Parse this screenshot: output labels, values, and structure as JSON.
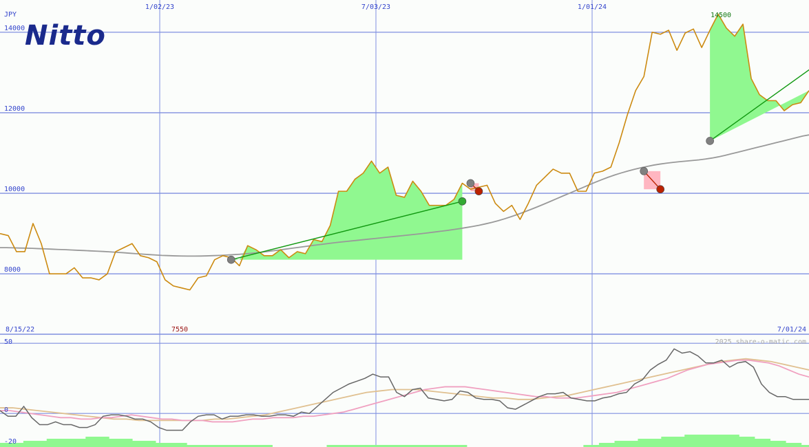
{
  "brand": {
    "logo_text": "Nitto",
    "logo_color": "#1a2a8c"
  },
  "watermark": "2025 share-o-matic.com",
  "colors": {
    "grid": "#7f8fe0",
    "price": "#cc8a10",
    "ma": "#999999",
    "profit_fill": "#90f890",
    "loss_fill": "#ffb6c1",
    "trade_line": "#119911",
    "buy_marker": "#808080",
    "win_marker": "#33aa33",
    "loss_marker": "#bb2200",
    "axis_text": "#3344cc",
    "high_text": "#117711",
    "low_text": "#991111",
    "osc_main": "#666666",
    "osc_signal1": "#f0a0c0",
    "osc_signal2": "#e0c090",
    "volume_fill": "#90f890"
  },
  "chart_data": [
    {
      "type": "line",
      "title": "",
      "currency_label": "JPY",
      "x_tick_labels": [
        "1/02/23",
        "7/03/23",
        "1/01/24"
      ],
      "x_start_label": "8/15/22",
      "x_end_label": "7/01/24",
      "y_ticks": [
        8000,
        10000,
        12000,
        14000
      ],
      "ylim": [
        6500,
        14800
      ],
      "high_label": "14500",
      "low_label": "7550",
      "series": [
        {
          "key": "price",
          "values": [
            9000,
            8950,
            8550,
            8550,
            9250,
            8750,
            8000,
            8000,
            8000,
            8150,
            7900,
            7900,
            7850,
            8000,
            8550,
            8650,
            8750,
            8450,
            8400,
            8300,
            7850,
            7700,
            7650,
            7600,
            7900,
            7950,
            8350,
            8450,
            8400,
            8200,
            8700,
            8600,
            8450,
            8450,
            8600,
            8400,
            8550,
            8500,
            8850,
            8800,
            9200,
            10050,
            10050,
            10350,
            10500,
            10800,
            10500,
            10650,
            9950,
            9900,
            10300,
            10050,
            9700,
            9700,
            9700,
            9850,
            10250,
            10100,
            10150,
            10200,
            9750,
            9550,
            9700,
            9350,
            9750,
            10200,
            10400,
            10600,
            10500,
            10500,
            10050,
            10050,
            10500,
            10550,
            10650,
            11250,
            11950,
            12550,
            12900,
            14000,
            13950,
            14050,
            13550,
            13980,
            14080,
            13620,
            14050,
            14450,
            14100,
            13900,
            14200,
            12850,
            12450,
            12300,
            12300,
            12050,
            12200,
            12250,
            12550
          ]
        },
        {
          "key": "ma",
          "values": [
            8650,
            8650,
            8645,
            8640,
            8638,
            8632,
            8625,
            8620,
            8612,
            8605,
            8600,
            8592,
            8585,
            8578,
            8570,
            8562,
            8555,
            8545,
            8535,
            8525,
            8512,
            8500,
            8490,
            8478,
            8468,
            8458,
            8452,
            8446,
            8442,
            8440,
            8440,
            8442,
            8446,
            8452,
            8458,
            8466,
            8476,
            8486,
            8498,
            8512,
            8528,
            8548,
            8568,
            8588,
            8610,
            8632,
            8654,
            8676,
            8698,
            8718,
            8738,
            8758,
            8778,
            8795,
            8812,
            8828,
            8845,
            8862,
            8878,
            8895,
            8912,
            8928,
            8945,
            8962,
            8978,
            8995,
            9015,
            9035,
            9055,
            9075,
            9098,
            9122,
            9148,
            9175,
            9205,
            9240,
            9278,
            9320,
            9368,
            9420,
            9476,
            9536,
            9598,
            9662,
            9728,
            9796,
            9866,
            9935,
            10002,
            10070,
            10138,
            10208,
            10276,
            10340,
            10400,
            10456,
            10506,
            10552,
            10594,
            10632,
            10668,
            10700,
            10726,
            10748,
            10768,
            10785,
            10800,
            10815,
            10830,
            10850,
            10875,
            10905,
            10940,
            10980,
            11020,
            11060,
            11100,
            11140,
            11180,
            11220,
            11260,
            11300,
            11340,
            11380,
            11420,
            11450
          ]
        }
      ],
      "trades": [
        {
          "entry_index": 28,
          "entry_value": 8350,
          "exit_index": 56,
          "exit_value": 9800,
          "result": "win"
        },
        {
          "entry_index": 57,
          "entry_value": 10250,
          "exit_index": 58,
          "exit_value": 10050,
          "result": "loss"
        },
        {
          "entry_index": 78,
          "entry_value": 10550,
          "exit_index": 80,
          "exit_value": 10100,
          "result": "loss"
        },
        {
          "entry_index": 86,
          "entry_value": 11300,
          "exit_index": 103,
          "exit_value": 13800,
          "result": "win"
        }
      ]
    },
    {
      "type": "line",
      "title": "",
      "y_ticks": [
        50,
        0,
        -20
      ],
      "ylim": [
        -20,
        55
      ],
      "series": [
        {
          "key": "oscillator",
          "values": [
            2,
            -2,
            -2,
            5,
            -3,
            -8,
            -8,
            -6,
            -8,
            -8,
            -10,
            -10,
            -8,
            -2,
            -1,
            -1,
            -2,
            -4,
            -4,
            -6,
            -10,
            -12,
            -12,
            -12,
            -6,
            -2,
            -1,
            -1,
            -4,
            -2,
            -2,
            -1,
            -1,
            -2,
            -2,
            -1,
            -1,
            -2,
            1,
            0,
            5,
            10,
            15,
            18,
            21,
            23,
            25,
            28,
            26,
            26,
            15,
            12,
            17,
            18,
            11,
            10,
            9,
            10,
            16,
            15,
            11,
            10,
            10,
            9,
            4,
            3,
            6,
            9,
            12,
            14,
            14,
            15,
            11,
            10,
            9,
            9,
            11,
            12,
            14,
            15,
            21,
            24,
            31,
            35,
            38,
            46,
            43,
            44,
            41,
            36,
            36,
            38,
            33,
            36,
            37,
            33,
            21,
            15,
            12,
            12,
            10,
            10,
            10
          ]
        },
        {
          "key": "signal1",
          "values": [
            2,
            2,
            1,
            0,
            -1,
            -2,
            -3,
            -3,
            -4,
            -4,
            -3,
            -3,
            -2,
            -1,
            -2,
            -3,
            -4,
            -4,
            -5,
            -5,
            -5,
            -6,
            -6,
            -6,
            -5,
            -4,
            -4,
            -3,
            -3,
            -3,
            -2,
            -2,
            -1,
            0,
            1,
            3,
            5,
            7,
            9,
            11,
            13,
            15,
            17,
            18,
            19,
            19,
            19,
            18,
            17,
            16,
            15,
            14,
            13,
            12,
            12,
            11,
            11,
            11,
            12,
            13,
            14,
            15,
            17,
            19,
            21,
            23,
            25,
            28,
            31,
            33,
            35,
            36,
            37,
            38,
            38,
            37,
            36,
            34,
            31,
            28,
            26
          ]
        },
        {
          "key": "signal2",
          "values": [
            4,
            4,
            3,
            2,
            1,
            0,
            -1,
            -2,
            -3,
            -4,
            -4,
            -5,
            -5,
            -5,
            -5,
            -5,
            -5,
            -4,
            -4,
            -3,
            -2,
            -1,
            1,
            3,
            5,
            7,
            9,
            11,
            13,
            15,
            16,
            17,
            17,
            17,
            16,
            15,
            14,
            13,
            12,
            11,
            11,
            10,
            10,
            11,
            12,
            13,
            15,
            17,
            19,
            21,
            23,
            25,
            27,
            29,
            31,
            33,
            35,
            37,
            38,
            39,
            38,
            37,
            35,
            33,
            31
          ]
        },
        {
          "key": "volume",
          "values": [
            2,
            2,
            2,
            3,
            3,
            3,
            4,
            4,
            4,
            4,
            4,
            5,
            5,
            5,
            4,
            4,
            4,
            3,
            3,
            3,
            2,
            2,
            2,
            2,
            1,
            1,
            1,
            1,
            1,
            1,
            1,
            1,
            1,
            1,
            1,
            0,
            0,
            0,
            0,
            0,
            0,
            0,
            1,
            1,
            1,
            1,
            1,
            1,
            1,
            1,
            1,
            1,
            1,
            1,
            1,
            1,
            1,
            1,
            1,
            1,
            0,
            0,
            0,
            0,
            0,
            0,
            0,
            0,
            0,
            0,
            0,
            0,
            0,
            0,
            0,
            1,
            1,
            2,
            2,
            3,
            3,
            3,
            4,
            4,
            4,
            5,
            5,
            5,
            6,
            6,
            6,
            6,
            6,
            6,
            6,
            5,
            5,
            4,
            4,
            3,
            3,
            2,
            2,
            1
          ]
        }
      ]
    }
  ]
}
